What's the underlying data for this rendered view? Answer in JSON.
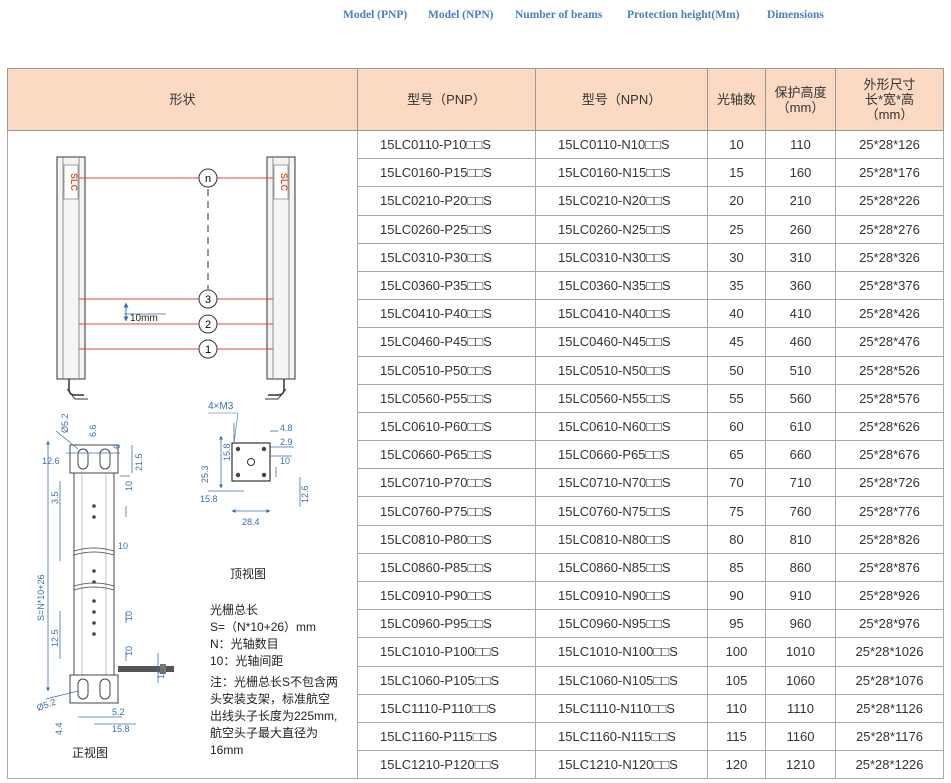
{
  "nav": {
    "items": [
      "Model (PNP)",
      "Model (NPN)",
      "Number of beams",
      "Protection height(Mm)",
      "Dimensions"
    ]
  },
  "table": {
    "headers": {
      "shape": "形状",
      "pnp": "型号（PNP）",
      "npn": "型号（NPN）",
      "beams": "光轴数",
      "height_l1": "保护高度",
      "height_l2": "（mm）",
      "dim_l1": "外形尺寸",
      "dim_l2": "长*宽*高",
      "dim_l3": "（mm）"
    },
    "rows": [
      {
        "pnp": "15LC0110-P10□□S",
        "npn": "15LC0110-N10□□S",
        "beams": "10",
        "height": "110",
        "dims": "25*28*126"
      },
      {
        "pnp": "15LC0160-P15□□S",
        "npn": "15LC0160-N15□□S",
        "beams": "15",
        "height": "160",
        "dims": "25*28*176"
      },
      {
        "pnp": "15LC0210-P20□□S",
        "npn": "15LC0210-N20□□S",
        "beams": "20",
        "height": "210",
        "dims": "25*28*226"
      },
      {
        "pnp": "15LC0260-P25□□S",
        "npn": "15LC0260-N25□□S",
        "beams": "25",
        "height": "260",
        "dims": "25*28*276"
      },
      {
        "pnp": "15LC0310-P30□□S",
        "npn": "15LC0310-N30□□S",
        "beams": "30",
        "height": "310",
        "dims": "25*28*326"
      },
      {
        "pnp": "15LC0360-P35□□S",
        "npn": "15LC0360-N35□□S",
        "beams": "35",
        "height": "360",
        "dims": "25*28*376"
      },
      {
        "pnp": "15LC0410-P40□□S",
        "npn": "15LC0410-N40□□S",
        "beams": "40",
        "height": "410",
        "dims": "25*28*426"
      },
      {
        "pnp": "15LC0460-P45□□S",
        "npn": "15LC0460-N45□□S",
        "beams": "45",
        "height": "460",
        "dims": "25*28*476"
      },
      {
        "pnp": "15LC0510-P50□□S",
        "npn": "15LC0510-N50□□S",
        "beams": "50",
        "height": "510",
        "dims": "25*28*526"
      },
      {
        "pnp": "15LC0560-P55□□S",
        "npn": "15LC0560-N55□□S",
        "beams": "55",
        "height": "560",
        "dims": "25*28*576"
      },
      {
        "pnp": "15LC0610-P60□□S",
        "npn": "15LC0610-N60□□S",
        "beams": "60",
        "height": "610",
        "dims": "25*28*626"
      },
      {
        "pnp": "15LC0660-P65□□S",
        "npn": "15LC0660-P65□□S",
        "beams": "65",
        "height": "660",
        "dims": "25*28*676"
      },
      {
        "pnp": "15LC0710-P70□□S",
        "npn": "15LC0710-N70□□S",
        "beams": "70",
        "height": "710",
        "dims": "25*28*726"
      },
      {
        "pnp": "15LC0760-P75□□S",
        "npn": "15LC0760-N75□□S",
        "beams": "75",
        "height": "760",
        "dims": "25*28*776"
      },
      {
        "pnp": "15LC0810-P80□□S",
        "npn": "15LC0810-N80□□S",
        "beams": "80",
        "height": "810",
        "dims": "25*28*826"
      },
      {
        "pnp": "15LC0860-P85□□S",
        "npn": "15LC0860-N85□□S",
        "beams": "85",
        "height": "860",
        "dims": "25*28*876"
      },
      {
        "pnp": "15LC0910-P90□□S",
        "npn": "15LC0910-N90□□S",
        "beams": "90",
        "height": "910",
        "dims": "25*28*926"
      },
      {
        "pnp": "15LC0960-P95□□S",
        "npn": "15LC0960-N95□□S",
        "beams": "95",
        "height": "960",
        "dims": "25*28*976"
      },
      {
        "pnp": "15LC1010-P100□□S",
        "npn": "15LC1010-N100□□S",
        "beams": "100",
        "height": "1010",
        "dims": "25*28*1026"
      },
      {
        "pnp": "15LC1060-P105□□S",
        "npn": "15LC1060-N105□□S",
        "beams": "105",
        "height": "1060",
        "dims": "25*28*1076"
      },
      {
        "pnp": "15LC1110-P110□□S",
        "npn": "15LC1110-N110□□S",
        "beams": "110",
        "height": "1110",
        "dims": "25*28*1126"
      },
      {
        "pnp": "15LC1160-P115□□S",
        "npn": "15LC1160-N115□□S",
        "beams": "115",
        "height": "1160",
        "dims": "25*28*1176"
      },
      {
        "pnp": "15LC1210-P120□□S",
        "npn": "15LC1210-N120□□S",
        "beams": "120",
        "height": "1210",
        "dims": "25*28*1226"
      }
    ]
  },
  "drawing": {
    "brand_left": "SLC",
    "brand_right": "SLC",
    "beam_n": "n",
    "beam_3": "3",
    "beam_2": "2",
    "beam_1": "1",
    "pitch_label": "10mm",
    "front": {
      "d52_top": "Ø5.2",
      "d66": "6.6",
      "d6": "6",
      "d126": "12.6",
      "d215": "21.5",
      "d35": "3.5",
      "d10a": "10",
      "s_formula": "S=N*10+26",
      "d10b": "10",
      "d10c": "10",
      "d125": "12.5",
      "d10d": "10",
      "d16": "16",
      "d52_bot": "Ø5.2",
      "d52b": "5.2",
      "d44": "4.4",
      "d158": "15.8",
      "caption": "正视图"
    },
    "top": {
      "m3": "4×M3",
      "d48": "4.8",
      "d158v": "15.8",
      "d29": "2.9",
      "d253": "25.3",
      "d10": "10",
      "d158h": "15.8",
      "d126": "12.6",
      "d284": "28.4",
      "caption": "顶视图"
    },
    "notes": [
      "光栅总长",
      "S=（N*10+26）mm",
      "N：光轴数目",
      "10：光轴间距",
      "注：光栅总长S不包含两",
      "头安装支架，标准航空",
      "出线头子长度为225mm,",
      "航空头子最大直径为",
      "16mm"
    ]
  },
  "colors": {
    "header_bg": "#fbd9c3",
    "nav_text": "#4a7fc0",
    "beam_line": "#e0463c",
    "brand": "#e05a2a"
  }
}
